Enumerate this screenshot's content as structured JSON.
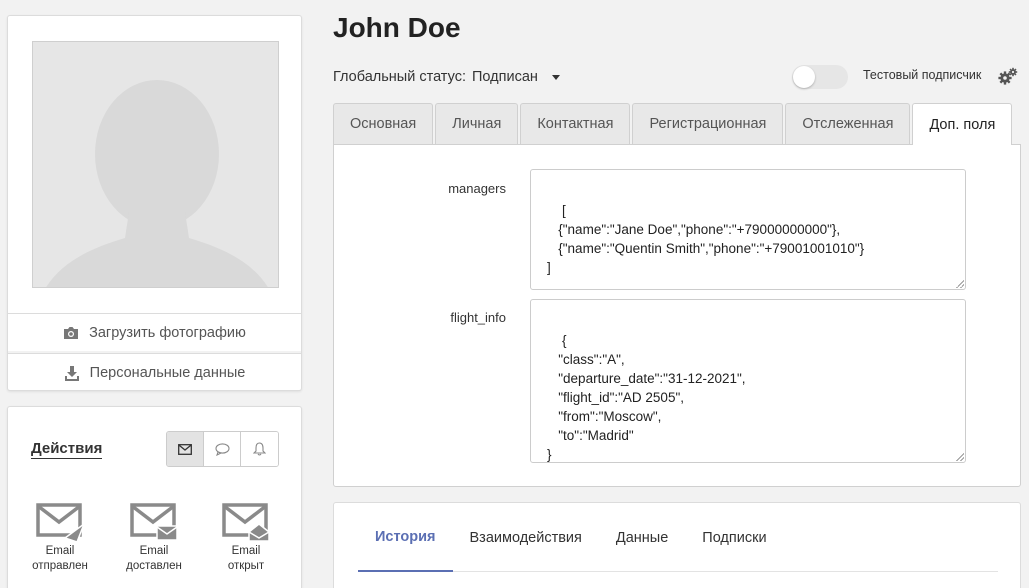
{
  "profile": {
    "name": "John Doe",
    "upload_photo": "Загрузить фотографию",
    "personal_data": "Персональные данные"
  },
  "status": {
    "label": "Глобальный статус:",
    "value": "Подписан"
  },
  "test_subscriber": {
    "label": "Тестовый подписчик",
    "enabled": false
  },
  "tabs": [
    {
      "label": "Основная"
    },
    {
      "label": "Личная"
    },
    {
      "label": "Контактная"
    },
    {
      "label": "Регистрационная"
    },
    {
      "label": "Отслеженная"
    },
    {
      "label": "Доп. поля",
      "active": true
    }
  ],
  "fields": [
    {
      "label": "managers",
      "value": "[\n   {\"name\":\"Jane Doe\",\"phone\":\"+79000000000\"},\n   {\"name\":\"Quentin Smith\",\"phone\":\"+79001001010\"}\n]"
    },
    {
      "label": "flight_info",
      "value": "{\n   \"class\":\"A\",\n   \"departure_date\":\"31-12-2021\",\n   \"flight_id\":\"AD 2505\",\n   \"from\":\"Moscow\",\n   \"to\":\"Madrid\"\n}"
    }
  ],
  "actions": {
    "title": "Действия",
    "channels": [
      "email-icon",
      "chat-icon",
      "bell-icon"
    ],
    "events": [
      {
        "line1": "Email",
        "line2": "отправлен",
        "icon": "email-sent-icon"
      },
      {
        "line1": "Email",
        "line2": "доставлен",
        "icon": "email-delivered-icon"
      },
      {
        "line1": "Email",
        "line2": "открыт",
        "icon": "email-opened-icon"
      }
    ]
  },
  "bottom_tabs": [
    {
      "label": "История",
      "active": true
    },
    {
      "label": "Взаимодействия"
    },
    {
      "label": "Данные"
    },
    {
      "label": "Подписки"
    }
  ],
  "colors": {
    "accent": "#5b6fb3",
    "background": "#f2f2f2",
    "icon_gray": "#8a8a8a"
  }
}
